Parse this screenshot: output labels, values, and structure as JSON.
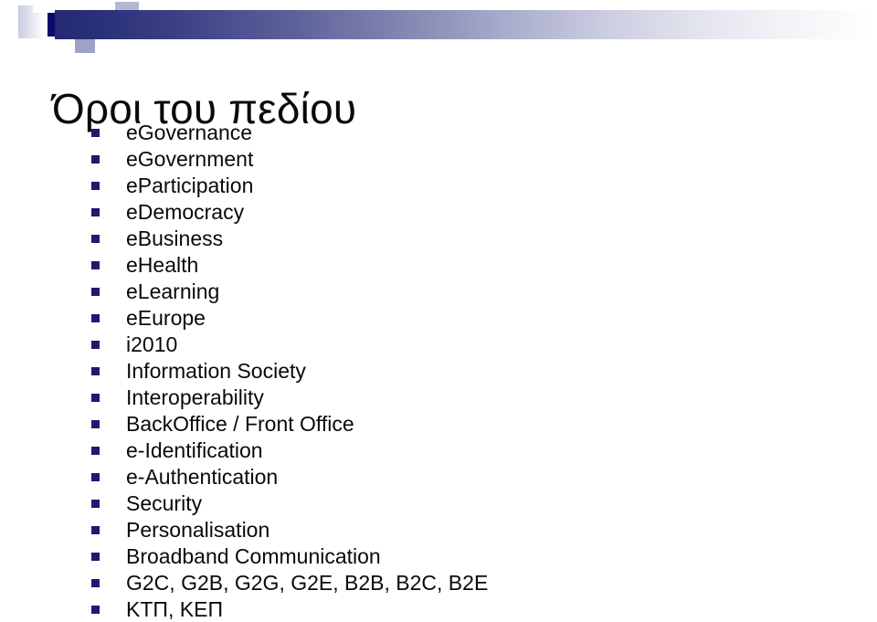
{
  "slide": {
    "title": "Όροι του πεδίου",
    "decoration": {
      "bar_gradient_start": "#242a72",
      "bar_gradient_end": "#ffffff",
      "accent_dark": "#0b0b6e",
      "accent_mid": "#9da2c6",
      "accent_light": "#c3c6de"
    },
    "bullet_color": "#1b1b72",
    "bullets": [
      {
        "label": "eGovernance"
      },
      {
        "label": "eGovernment"
      },
      {
        "label": "eParticipation"
      },
      {
        "label": "eDemocracy"
      },
      {
        "label": "eBusiness"
      },
      {
        "label": "eHealth"
      },
      {
        "label": "eLearning"
      },
      {
        "label": "eEurope"
      },
      {
        "label": "i2010"
      },
      {
        "label": "Information Society"
      },
      {
        "label": "Interoperability"
      },
      {
        "label": "BackOffice / Front Office"
      },
      {
        "label": "e-Identification"
      },
      {
        "label": "e-Authentication"
      },
      {
        "label": "Security"
      },
      {
        "label": "Personalisation"
      },
      {
        "label": "Broadband Communication"
      },
      {
        "label": "G2C, G2B, G2G, G2E, B2B, B2C, B2E"
      },
      {
        "label": "ΚΤΠ, ΚΕΠ"
      }
    ]
  }
}
